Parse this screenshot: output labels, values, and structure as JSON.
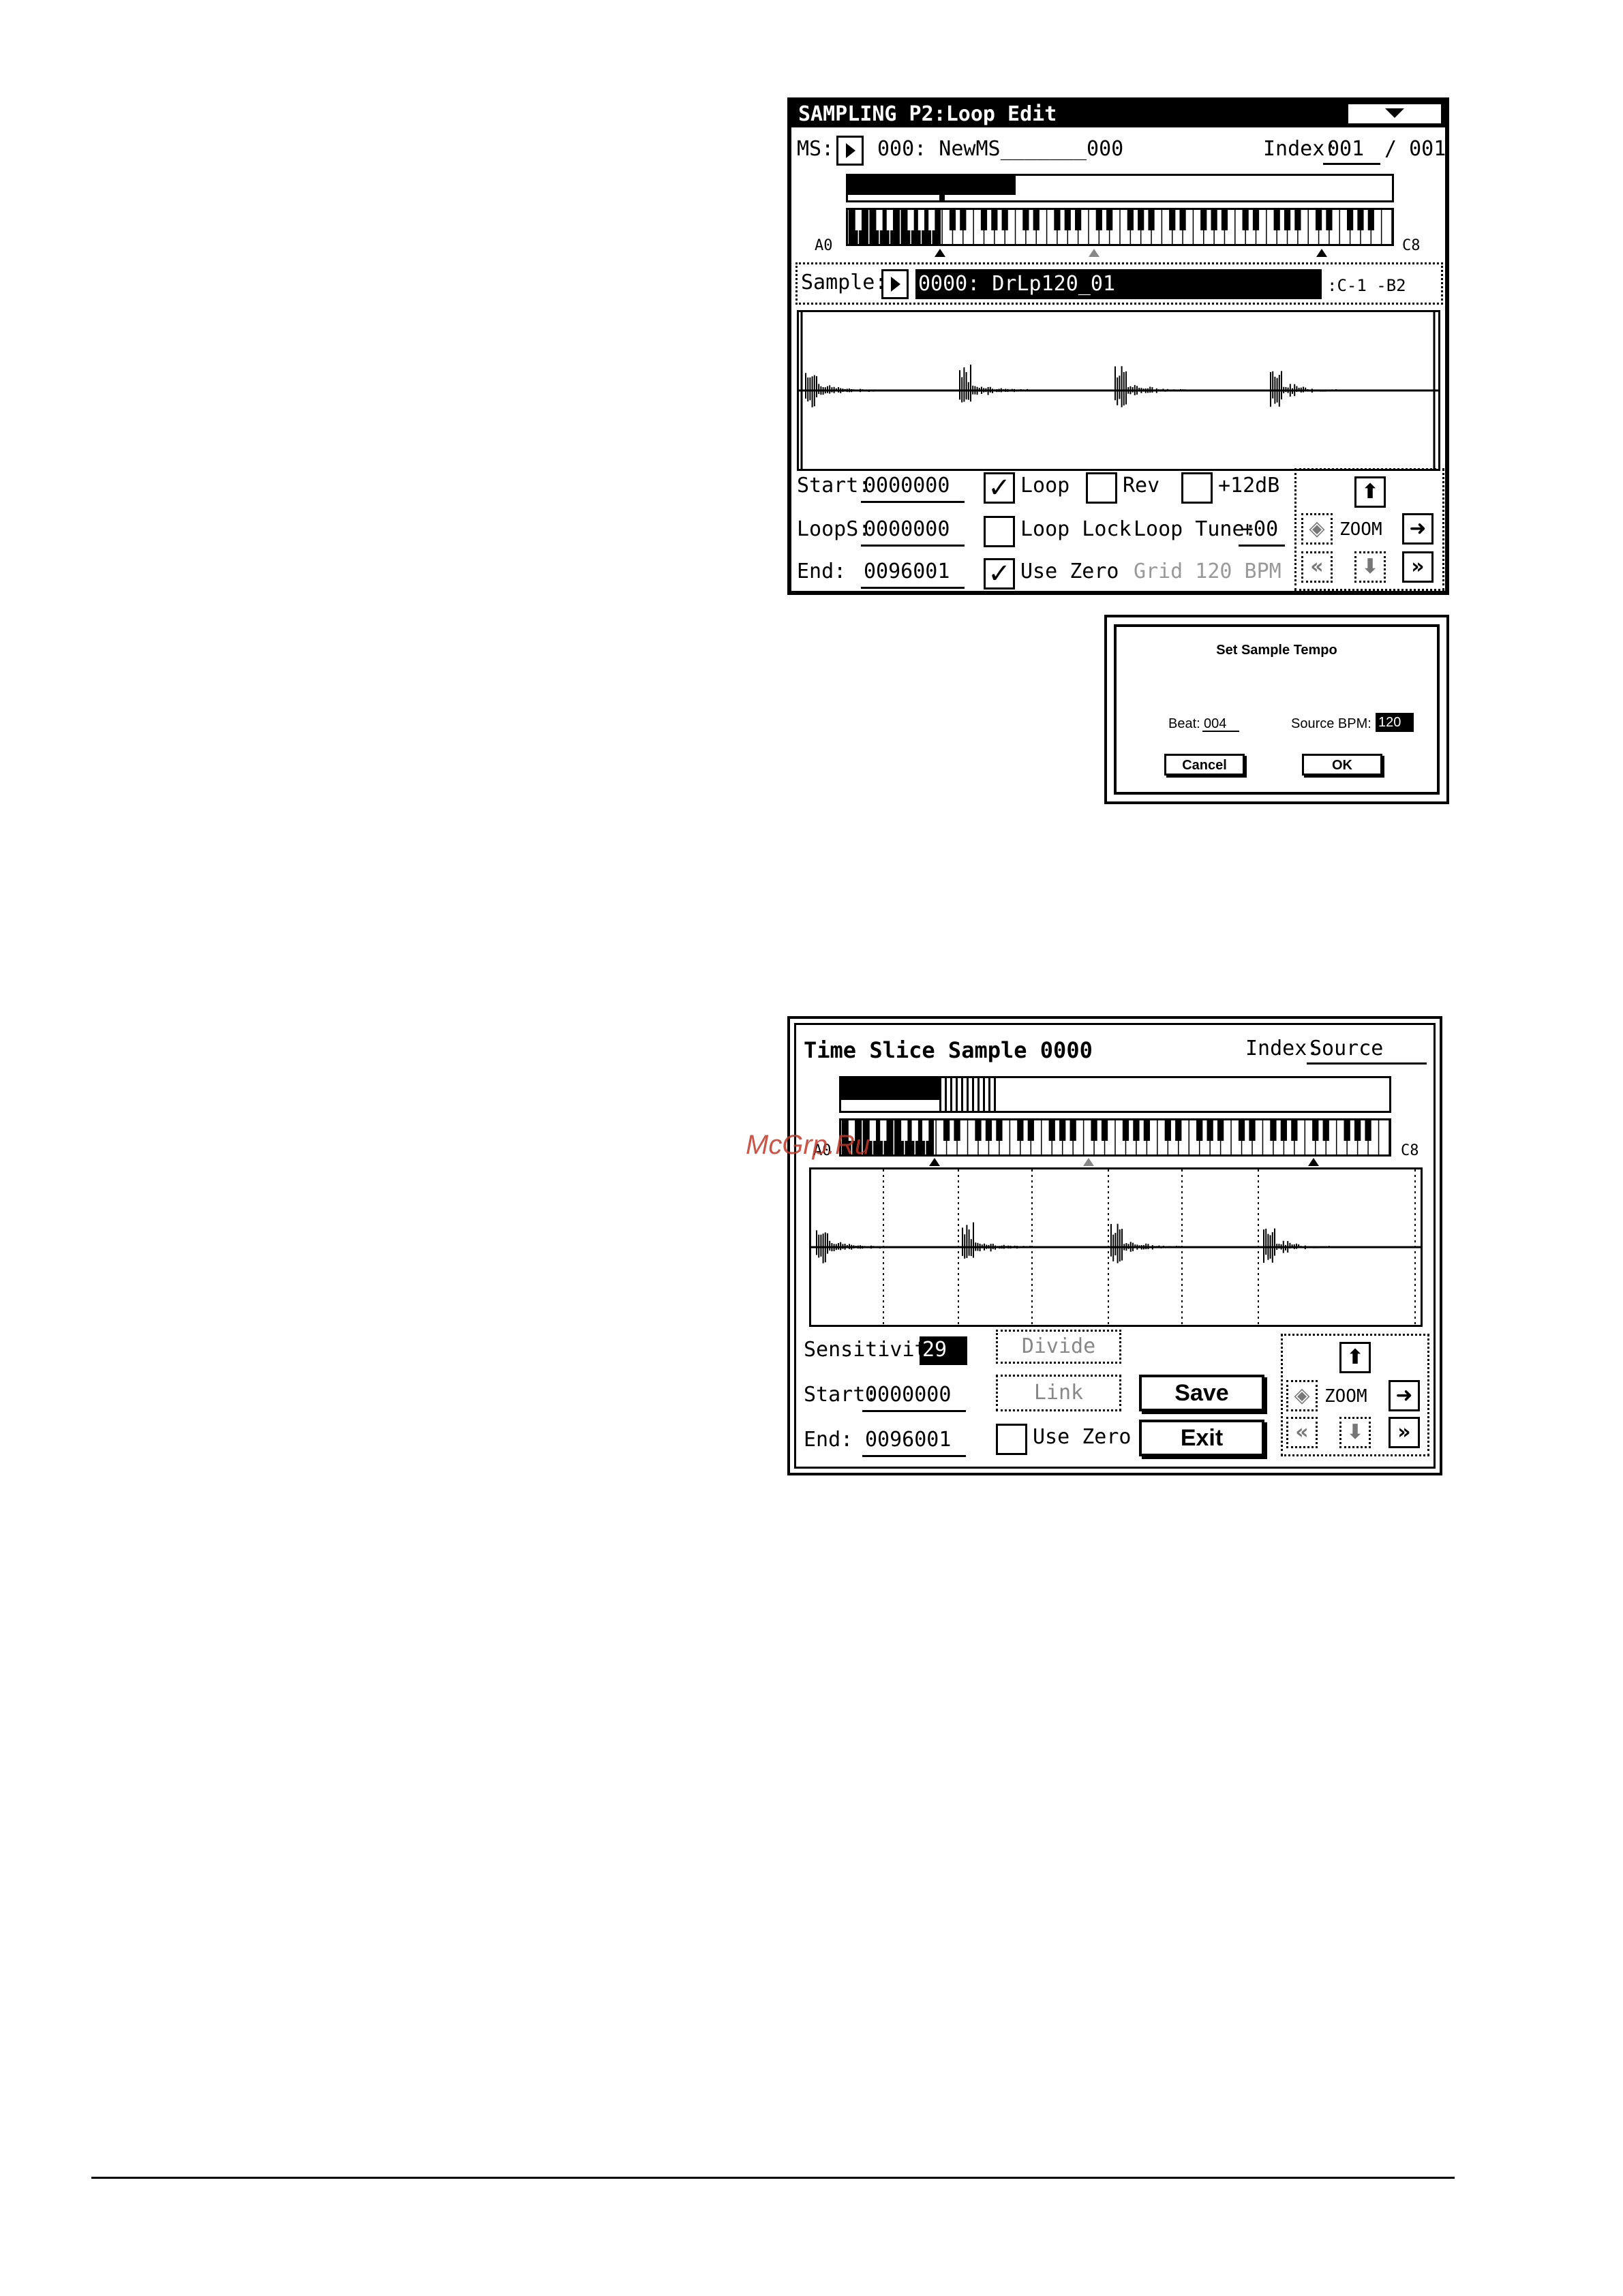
{
  "loop_edit": {
    "title": "SAMPLING P2:Loop Edit",
    "ms_label": "MS:",
    "ms_value": "000: NewMS_______000",
    "index_label": "Index:",
    "index_value": "001",
    "index_total": "/ 001",
    "kb_low": "A0",
    "kb_high": "C8",
    "sample_label": "Sample:",
    "sample_value": "0000: DrLp120_01",
    "sample_range": ":C-1  -B2",
    "start_label": "Start:",
    "start_value": "0000000",
    "loops_label": "LoopS:",
    "loops_value": "0000000",
    "end_label": "End:",
    "end_value": "0096001",
    "loop_label": "Loop",
    "loop_checked": true,
    "rev_label": "Rev",
    "rev_checked": false,
    "plus12_label": "+12dB",
    "plus12_checked": false,
    "looplock_label": "Loop Lock",
    "looplock_checked": false,
    "looptune_label": "Loop Tune:",
    "looptune_value": "+00",
    "usezero_label": "Use Zero",
    "usezero_checked": true,
    "grid_label": "Grid 120 BPM",
    "zoom_label": "ZOOM"
  },
  "tempo_dialog": {
    "title": "Set Sample Tempo",
    "beat_label": "Beat:",
    "beat_value": "004",
    "bpm_label": "Source BPM:",
    "bpm_value": "120",
    "cancel": "Cancel",
    "ok": "OK"
  },
  "time_slice": {
    "title": "Time Slice Sample 0000",
    "index_label": "Index:",
    "index_value": "Source",
    "kb_low": "A0",
    "kb_high": "C8",
    "sensitivity_label": "Sensitivity:",
    "sensitivity_value": "29",
    "divide": "Divide",
    "link": "Link",
    "start_label": "Start:",
    "start_value": "0000000",
    "end_label": "End:",
    "end_value": "0096001",
    "usezero_label": "Use Zero",
    "usezero_checked": false,
    "save": "Save",
    "exit": "Exit",
    "zoom_label": "ZOOM"
  },
  "watermark": "McGrp.Ru"
}
